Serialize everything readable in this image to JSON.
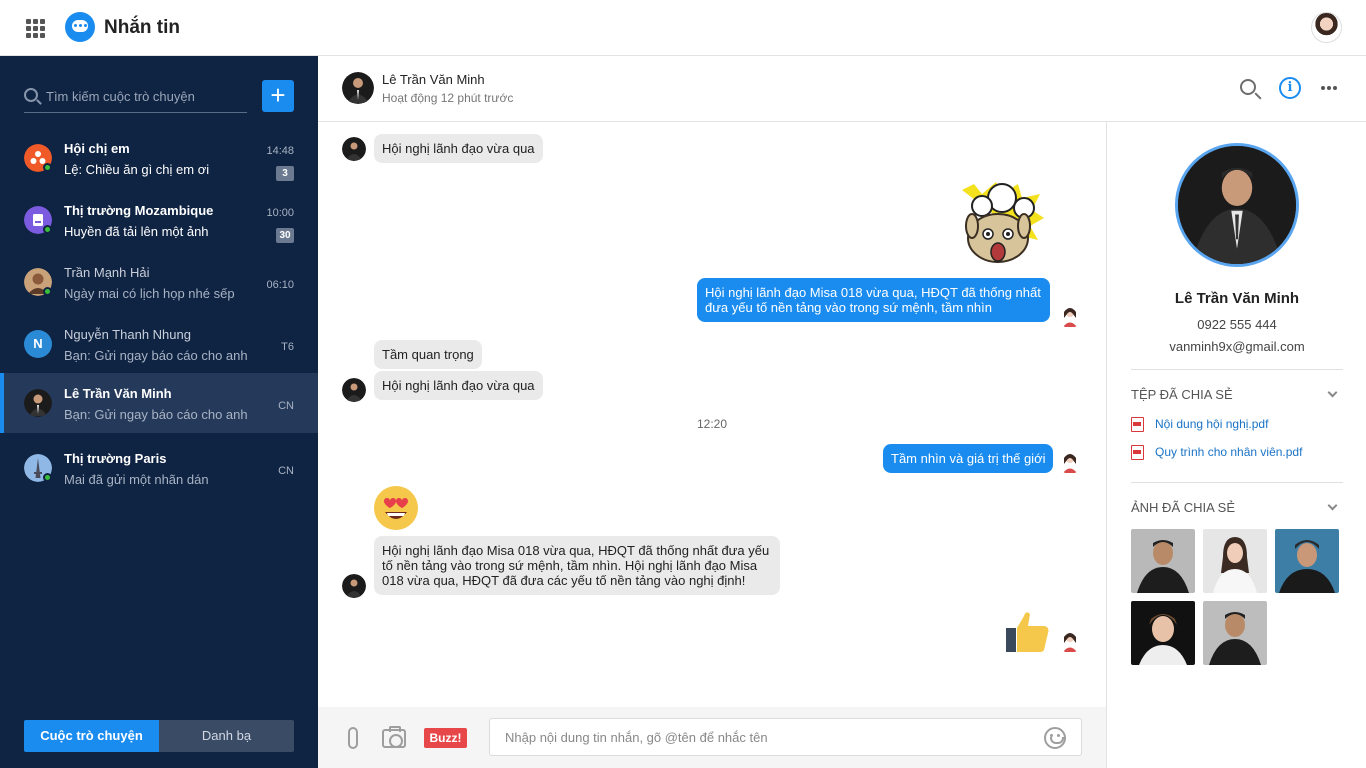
{
  "app": {
    "title": "Nhắn tin"
  },
  "sidebar": {
    "search_placeholder": "Tìm kiếm cuộc trò chuyện",
    "conversations": [
      {
        "name": "Hội chị em",
        "preview": "Lệ: Chiều ăn gì chị em ơi",
        "time": "14:48",
        "badge": "3",
        "unread": true
      },
      {
        "name": "Thị trường Mozambique",
        "preview": "Huyền đã tải lên một ảnh",
        "time": "10:00",
        "badge": "30",
        "unread": true
      },
      {
        "name": "Trần Mạnh Hải",
        "preview": "Ngày mai có lịch họp nhé sếp",
        "time": "06:10",
        "unread": false
      },
      {
        "name": "Nguyễn Thanh Nhung",
        "preview": "Bạn: Gửi ngay báo cáo cho anh",
        "time": "T6",
        "avatar_letter": "N",
        "unread": false
      },
      {
        "name": "Lê Trần Văn Minh",
        "preview": "Bạn: Gửi ngay báo cáo cho anh",
        "time": "CN",
        "unread": false,
        "active": true
      },
      {
        "name": "Thị trường Paris",
        "preview": "Mai đã gửi một nhãn dán",
        "time": "CN",
        "unread": false
      }
    ],
    "tabs": {
      "conversations": "Cuộc trò chuyện",
      "contacts": "Danh bạ"
    }
  },
  "chat": {
    "contact_name": "Lê Trần Văn Minh",
    "status": "Hoạt động 12 phút trước",
    "messages": [
      {
        "from": "them",
        "text": "Hội nghị lãnh đạo vừa qua"
      },
      {
        "from": "me",
        "type": "sticker",
        "sticker": "shocked-bunny-sticker"
      },
      {
        "from": "me",
        "text": "Hội nghị lãnh đạo Misa 018 vừa qua, HĐQT đã thống nhất đưa yếu tố nền tảng vào trong sứ mệnh, tầm nhìn"
      },
      {
        "from": "them",
        "text": "Tầm quan trọng"
      },
      {
        "from": "them",
        "text": "Hội nghị lãnh đạo vừa qua"
      },
      {
        "type": "time",
        "text": "12:20"
      },
      {
        "from": "me",
        "text": "Tầm nhìn và giá trị thế giới"
      },
      {
        "from": "them",
        "type": "emoji",
        "emoji": "heart-eyes-emoji"
      },
      {
        "from": "them",
        "text": "Hội nghị lãnh đạo Misa 018 vừa qua, HĐQT đã thống nhất đưa yếu tố nền tảng vào trong sứ mệnh, tầm nhìn. Hội nghị lãnh đạo Misa 018 vừa qua, HĐQT đã đưa các yếu tố nền tảng vào nghị định!"
      },
      {
        "from": "me",
        "type": "emoji",
        "emoji": "thumbs-up-emoji"
      }
    ],
    "input": {
      "placeholder": "Nhập nội dung tin nhắn, gõ @tên để nhắc tên",
      "buzz_label": "Buzz!"
    }
  },
  "info": {
    "name": "Lê Trần Văn Minh",
    "phone": "0922 555 444",
    "email": "vanminh9x@gmail.com",
    "files_title": "TỆP ĐÃ CHIA SẺ",
    "files": [
      "Nội dung hội nghị.pdf",
      "Quy trình cho nhân viên.pdf"
    ],
    "photos_title": "ẢNH ĐÃ CHIA SẺ",
    "photos_count": 5
  },
  "colors": {
    "accent": "#1a8cf0",
    "sidebar_bg": "#0f2342",
    "buzz": "#e8474a"
  }
}
